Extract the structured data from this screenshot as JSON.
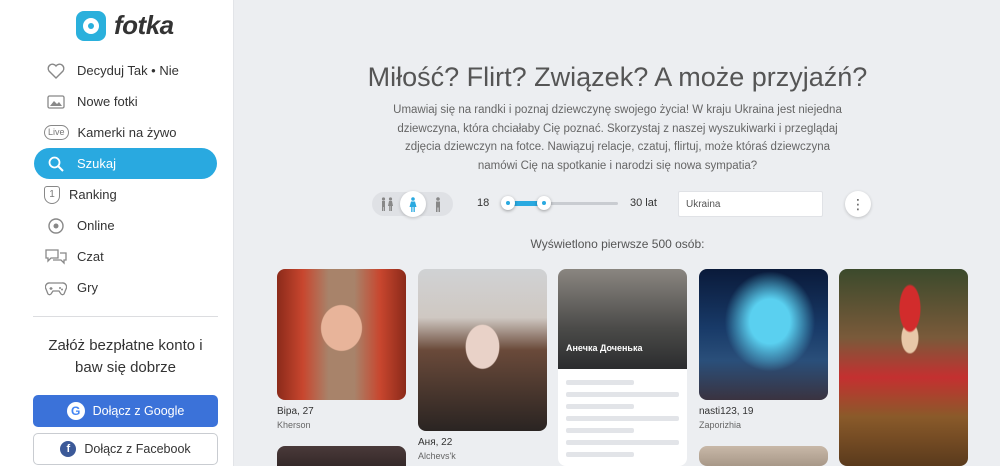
{
  "brand": {
    "name": "fotka"
  },
  "sidebar": {
    "items": [
      {
        "label": "Decyduj Tak • Nie",
        "icon": "heart-icon"
      },
      {
        "label": "Nowe fotki",
        "icon": "photos-icon"
      },
      {
        "label": "Kamerki na żywo",
        "icon": "live-icon",
        "icon_text": "Live"
      },
      {
        "label": "Szukaj",
        "icon": "search-icon"
      },
      {
        "label": "Ranking",
        "icon": "ranking-icon",
        "icon_text": "1"
      },
      {
        "label": "Online",
        "icon": "online-icon"
      },
      {
        "label": "Czat",
        "icon": "chat-icon"
      },
      {
        "label": "Gry",
        "icon": "gamepad-icon"
      }
    ],
    "active_item": "Szukaj",
    "cta_text": "Załóż bezpłatne konto i baw się dobrze",
    "google_button": "Dołącz z Google",
    "facebook_button": "Dołącz z Facebook"
  },
  "main": {
    "headline": "Miłość? Flirt? Związek? A może przyjaźń?",
    "intro": "Umawiaj się na randki i poznaj dziewczynę swojego życia! W kraju Ukraina jest niejedna dziewczyna, która  chciałaby Cię poznać. Skorzystaj z naszej wyszukiwarki i przeglądaj zdjęcia dziewczyn na fotce. Nawiązuj relacje, czatuj, flirtuj, może któraś dziewczyna namówi Cię na spotkanie i narodzi się nowa sympatia?",
    "filters": {
      "gender_options": [
        "both",
        "female",
        "male"
      ],
      "gender_selected": "female",
      "age_min": "18",
      "age_max": "30 lat",
      "country_value": "Ukraina"
    },
    "shown_count": "Wyświetlono pierwsze 500 osób:",
    "profiles": [
      {
        "name": "Віра, 27",
        "location": "Kherson"
      },
      {
        "name": "Аня, 22",
        "location": "Alchevs'k"
      },
      {
        "name": "",
        "location": "",
        "photo_caption": "Анечка Доченька"
      },
      {
        "name": "nasti123, 19",
        "location": "Zaporizhia"
      },
      {
        "name": "",
        "location": ""
      }
    ]
  },
  "colors": {
    "accent": "#29a9e0",
    "google_button": "#3b72d9",
    "background": "#eceef1"
  }
}
